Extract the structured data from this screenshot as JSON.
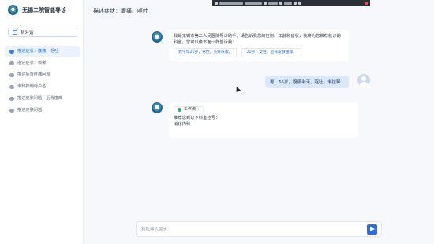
{
  "app": {
    "title": "无锡二院智能导诊"
  },
  "sidebar": {
    "new_chat_label": "新对话",
    "items": [
      {
        "label": "描述症状：腹痛、呕吐",
        "active": true
      },
      {
        "label": "描述症状：咳嗽",
        "active": false
      },
      {
        "label": "描述后背疼痛问题",
        "active": false
      },
      {
        "label": "未知摔倒用户名",
        "active": false
      },
      {
        "label": "描述皮肤问题：后背瘙痒",
        "active": false
      },
      {
        "label": "描述皮肤问题",
        "active": false
      }
    ]
  },
  "header": {
    "conversation_title": "描述症状：腹痛、呕吐"
  },
  "messages": {
    "bot_intro": "我是无锡市第二人民医院导诊助手，请告诉我您的性别、年龄和症状，我将为您推荐就诊的科室。您可以像下面一样告诉我：",
    "examples": [
      "我今年20岁，男性，头疼咳嗽。",
      "20岁，女性，后背皮肤瘙痒。"
    ],
    "user_text": "男，65岁，腹痛半天，呕吐，未拉稀",
    "workspace_tag": "工作流",
    "bot_reply_line1": "推荐您到以下科室挂号：",
    "bot_reply_line2": "消化内科"
  },
  "input": {
    "placeholder": "和机器人聊天"
  },
  "colors": {
    "accent": "#2e6fe0",
    "active_bg": "#e9f2fd",
    "user_bubble": "#dbe8fb",
    "success": "#36b36b"
  },
  "icons": {
    "logo": "hospital-logo-icon",
    "new_chat": "edit-icon",
    "history": "chat-bubble-icon",
    "send": "send-icon",
    "status": "check-circle-icon"
  }
}
